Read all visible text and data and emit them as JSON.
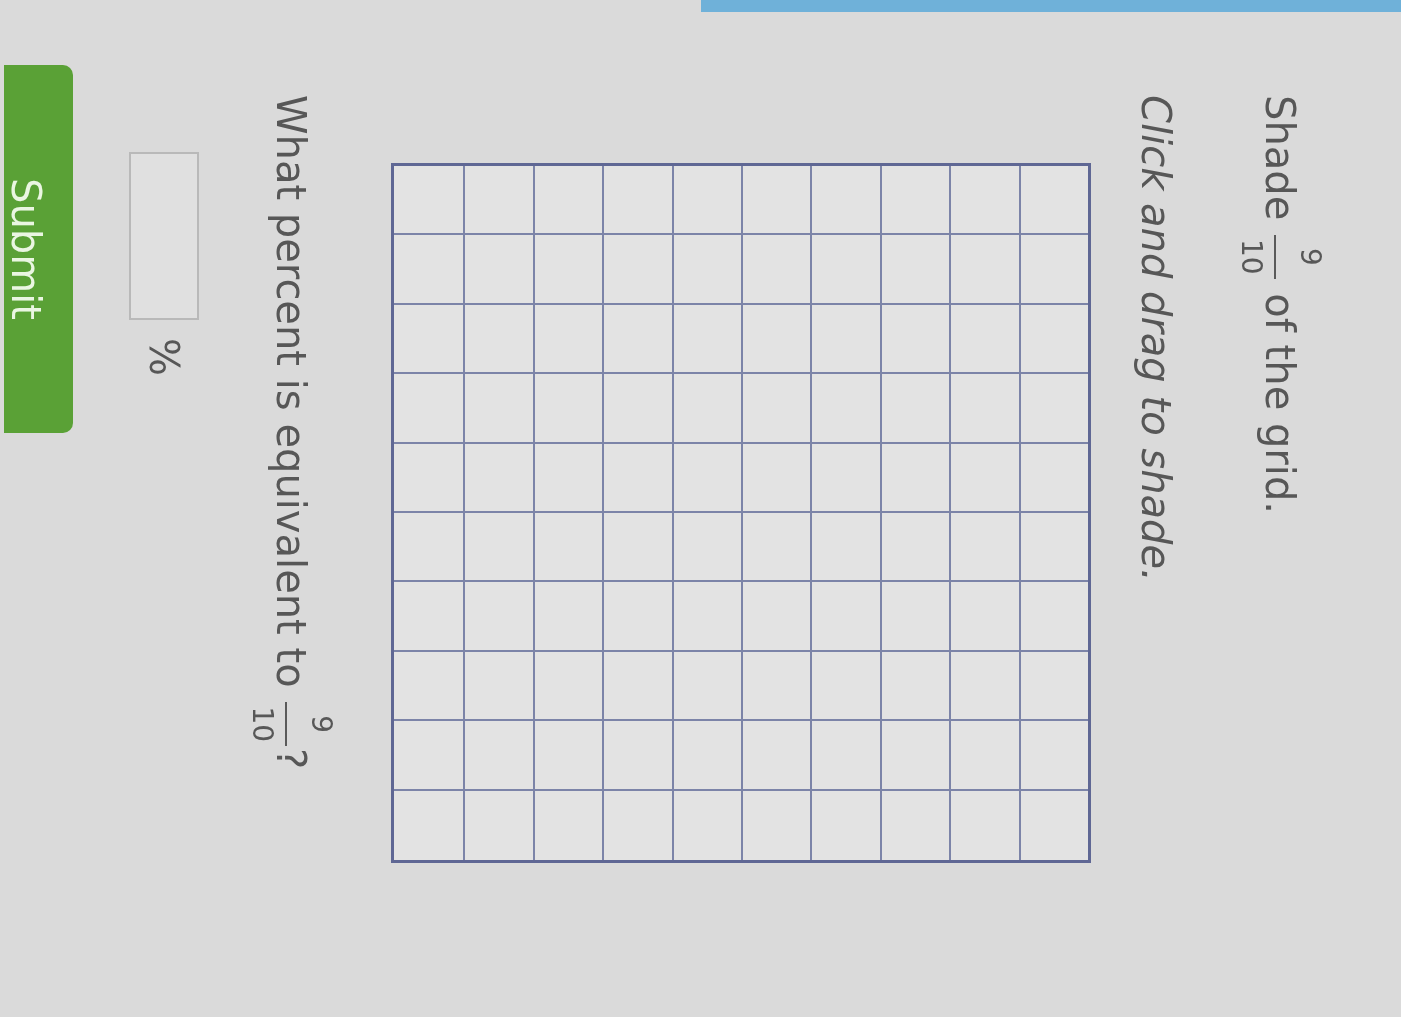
{
  "prompt": {
    "text_before": "Shade",
    "fraction": {
      "numerator": "9",
      "denominator": "10"
    },
    "text_after": "of the grid."
  },
  "instruction": "Click and drag to shade.",
  "grid": {
    "rows": [
      {
        "cells": [
          {
            "shaded": false
          },
          {
            "shaded": false
          },
          {
            "shaded": false
          },
          {
            "shaded": false
          },
          {
            "shaded": false
          },
          {
            "shaded": false
          },
          {
            "shaded": false
          },
          {
            "shaded": false
          },
          {
            "shaded": false
          },
          {
            "shaded": false
          }
        ]
      },
      {
        "cells": [
          {
            "shaded": false
          },
          {
            "shaded": false
          },
          {
            "shaded": false
          },
          {
            "shaded": false
          },
          {
            "shaded": false
          },
          {
            "shaded": false
          },
          {
            "shaded": false
          },
          {
            "shaded": false
          },
          {
            "shaded": false
          },
          {
            "shaded": false
          }
        ]
      },
      {
        "cells": [
          {
            "shaded": false
          },
          {
            "shaded": false
          },
          {
            "shaded": false
          },
          {
            "shaded": false
          },
          {
            "shaded": false
          },
          {
            "shaded": false
          },
          {
            "shaded": false
          },
          {
            "shaded": false
          },
          {
            "shaded": false
          },
          {
            "shaded": false
          }
        ]
      },
      {
        "cells": [
          {
            "shaded": false
          },
          {
            "shaded": false
          },
          {
            "shaded": false
          },
          {
            "shaded": false
          },
          {
            "shaded": false
          },
          {
            "shaded": false
          },
          {
            "shaded": false
          },
          {
            "shaded": false
          },
          {
            "shaded": false
          },
          {
            "shaded": false
          }
        ]
      },
      {
        "cells": [
          {
            "shaded": false
          },
          {
            "shaded": false
          },
          {
            "shaded": false
          },
          {
            "shaded": false
          },
          {
            "shaded": false
          },
          {
            "shaded": false
          },
          {
            "shaded": false
          },
          {
            "shaded": false
          },
          {
            "shaded": false
          },
          {
            "shaded": false
          }
        ]
      },
      {
        "cells": [
          {
            "shaded": false
          },
          {
            "shaded": false
          },
          {
            "shaded": false
          },
          {
            "shaded": false
          },
          {
            "shaded": false
          },
          {
            "shaded": false
          },
          {
            "shaded": false
          },
          {
            "shaded": false
          },
          {
            "shaded": false
          },
          {
            "shaded": false
          }
        ]
      },
      {
        "cells": [
          {
            "shaded": false
          },
          {
            "shaded": false
          },
          {
            "shaded": false
          },
          {
            "shaded": false
          },
          {
            "shaded": false
          },
          {
            "shaded": false
          },
          {
            "shaded": false
          },
          {
            "shaded": false
          },
          {
            "shaded": false
          },
          {
            "shaded": false
          }
        ]
      },
      {
        "cells": [
          {
            "shaded": false
          },
          {
            "shaded": false
          },
          {
            "shaded": false
          },
          {
            "shaded": false
          },
          {
            "shaded": false
          },
          {
            "shaded": false
          },
          {
            "shaded": false
          },
          {
            "shaded": false
          },
          {
            "shaded": false
          },
          {
            "shaded": false
          }
        ]
      },
      {
        "cells": [
          {
            "shaded": false
          },
          {
            "shaded": false
          },
          {
            "shaded": false
          },
          {
            "shaded": false
          },
          {
            "shaded": false
          },
          {
            "shaded": false
          },
          {
            "shaded": false
          },
          {
            "shaded": false
          },
          {
            "shaded": false
          },
          {
            "shaded": false
          }
        ]
      },
      {
        "cells": [
          {
            "shaded": false
          },
          {
            "shaded": false
          },
          {
            "shaded": false
          },
          {
            "shaded": false
          },
          {
            "shaded": false
          },
          {
            "shaded": false
          },
          {
            "shaded": false
          },
          {
            "shaded": false
          },
          {
            "shaded": false
          },
          {
            "shaded": false
          }
        ]
      }
    ]
  },
  "question": {
    "text_before": "What percent is equivalent to",
    "fraction": {
      "numerator": "9",
      "denominator": "10"
    },
    "text_after": "?"
  },
  "answer": {
    "unit": "%"
  },
  "submit_button": {
    "label": "Submit"
  }
}
